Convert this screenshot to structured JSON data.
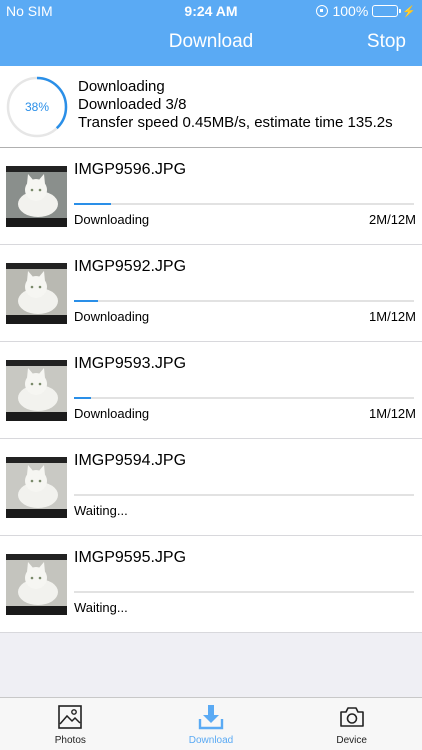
{
  "status_bar": {
    "carrier": "No SIM",
    "time": "9:24 AM",
    "battery": "100%"
  },
  "nav": {
    "title": "Download",
    "stop_label": "Stop"
  },
  "summary": {
    "progress_percent": 38,
    "progress_label": "38%",
    "line1": "Downloading",
    "line2": "Downloaded 3/8",
    "line3": "Transfer speed 0.45MB/s, estimate time 135.2s"
  },
  "files": [
    {
      "name": "IMGP9596.JPG",
      "state": "Downloading",
      "size": "2M/12M",
      "progress": 0.11
    },
    {
      "name": "IMGP9592.JPG",
      "state": "Downloading",
      "size": "1M/12M",
      "progress": 0.07
    },
    {
      "name": "IMGP9593.JPG",
      "state": "Downloading",
      "size": "1M/12M",
      "progress": 0.05
    },
    {
      "name": "IMGP9594.JPG",
      "state": "Waiting...",
      "size": "",
      "progress": 0
    },
    {
      "name": "IMGP9595.JPG",
      "state": "Waiting...",
      "size": "",
      "progress": 0
    }
  ],
  "tabs": [
    {
      "label": "Photos",
      "icon": "photo-icon",
      "active": false
    },
    {
      "label": "Download",
      "icon": "download-icon",
      "active": true
    },
    {
      "label": "Device",
      "icon": "camera-icon",
      "active": false
    }
  ],
  "colors": {
    "accent": "#5aaaf4",
    "progress": "#2a8fe8"
  }
}
